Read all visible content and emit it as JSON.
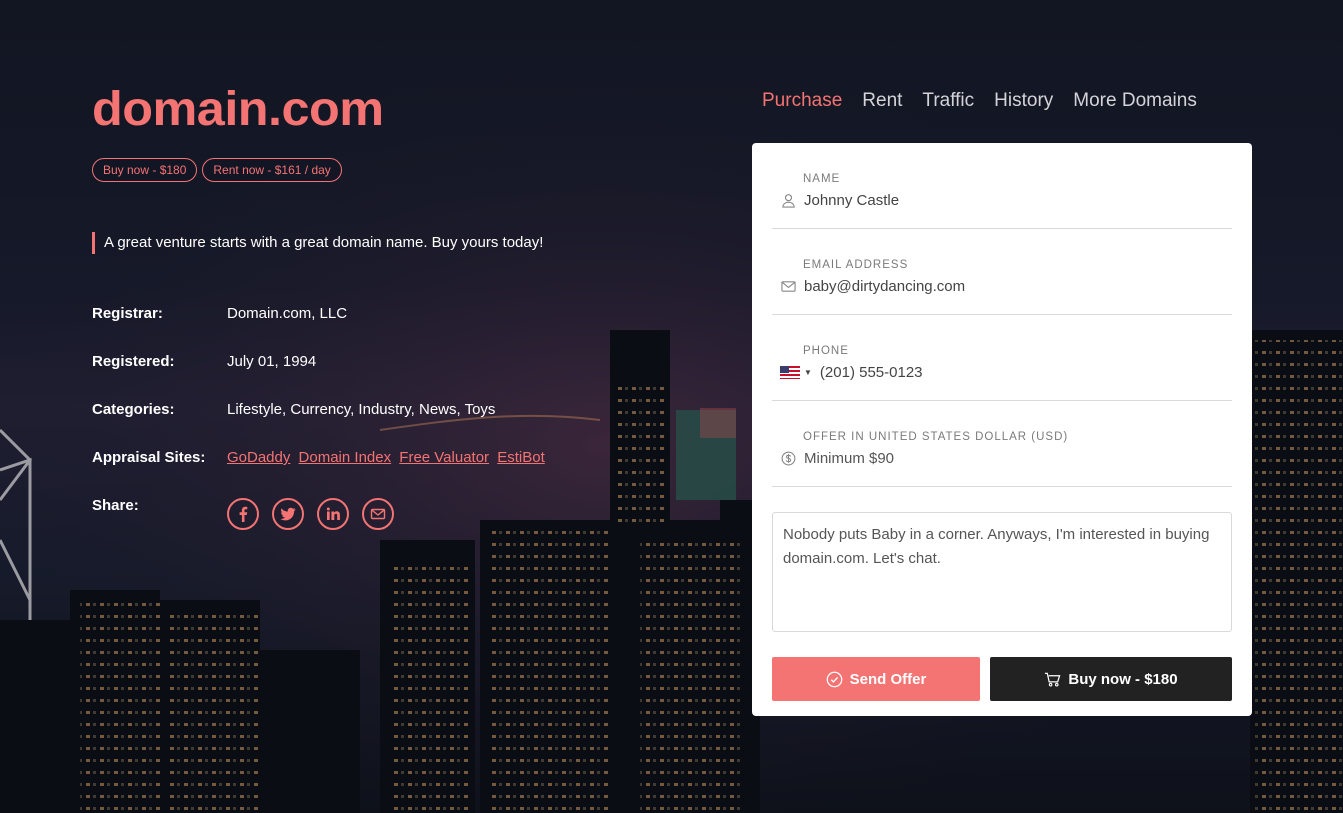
{
  "brand": {
    "logo": "domain.com",
    "accent": "#f47373"
  },
  "pills": {
    "buy": "Buy now - $180",
    "rent": "Rent now - $161 / day"
  },
  "tagline": "A great venture starts with a great domain name. Buy yours today!",
  "info": {
    "registrar_label": "Registrar:",
    "registrar_value": "Domain.com, LLC",
    "registered_label": "Registered:",
    "registered_value": "July 01, 1994",
    "categories_label": "Categories:",
    "categories_value": "Lifestyle, Currency, Industry, News, Toys",
    "appraisal_label": "Appraisal Sites:",
    "appraisal_links": [
      "GoDaddy",
      "Domain Index",
      "Free Valuator",
      "EstiBot"
    ],
    "share_label": "Share:",
    "share_icons": [
      "facebook-icon",
      "twitter-icon",
      "linkedin-icon",
      "email-icon"
    ]
  },
  "nav": {
    "items": [
      "Purchase",
      "Rent",
      "Traffic",
      "History",
      "More Domains"
    ],
    "active": "Purchase"
  },
  "form": {
    "name_label": "NAME",
    "name_value": "Johnny Castle",
    "email_label": "EMAIL ADDRESS",
    "email_value": "baby@dirtydancing.com",
    "phone_label": "PHONE",
    "phone_value": "(201) 555-0123",
    "offer_label": "OFFER IN UNITED STATES DOLLAR (USD)",
    "offer_placeholder": "Minimum $90",
    "message_value": "Nobody puts Baby in a corner. Anyways, I'm interested in buying domain.com. Let's chat.",
    "send_label": "Send Offer",
    "buy_label": "Buy now - $180"
  }
}
